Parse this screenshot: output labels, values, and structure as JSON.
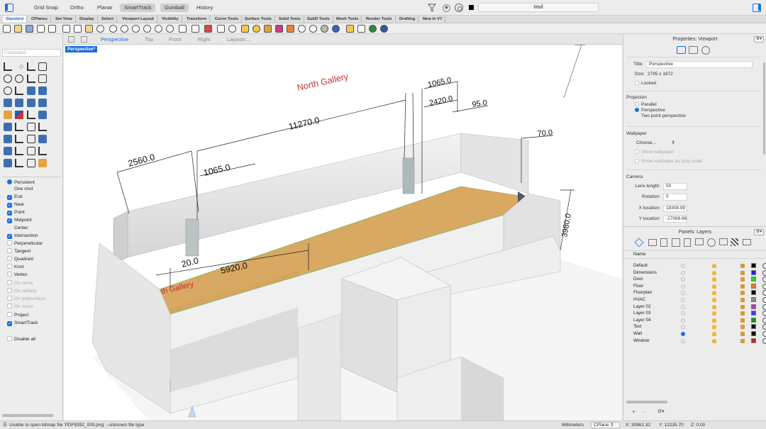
{
  "topbar": {
    "modes": [
      {
        "label": "Grid Snap",
        "on": false
      },
      {
        "label": "Ortho",
        "on": false
      },
      {
        "label": "Planar",
        "on": false
      },
      {
        "label": "SmartTrack",
        "on": true
      },
      {
        "label": "Gumball",
        "on": true
      },
      {
        "label": "History",
        "on": false
      }
    ],
    "current_layer": "Wall"
  },
  "tabs": [
    "Standard",
    "CPlanes",
    "Set View",
    "Display",
    "Select",
    "Viewport Layout",
    "Visibility",
    "Transform",
    "Curve Tools",
    "Surface Tools",
    "Solid Tools",
    "SubD Tools",
    "Mesh Tools",
    "Render Tools",
    "Drafting",
    "New in V7"
  ],
  "command": {
    "placeholder": "Command"
  },
  "osnaps": [
    {
      "label": "Persistent",
      "state": "radio-on"
    },
    {
      "label": "One shot",
      "state": "nobox"
    },
    {
      "label": "End",
      "state": "checked"
    },
    {
      "label": "Near",
      "state": "checked"
    },
    {
      "label": "Point",
      "state": "checked"
    },
    {
      "label": "Midpoint",
      "state": "checked"
    },
    {
      "label": "Center",
      "state": "nobox"
    },
    {
      "label": "Intersection",
      "state": "checked"
    },
    {
      "label": "Perpendicular",
      "state": "unchecked"
    },
    {
      "label": "Tangent",
      "state": "unchecked"
    },
    {
      "label": "Quadrant",
      "state": "unchecked"
    },
    {
      "label": "Knot",
      "state": "unchecked"
    },
    {
      "label": "Vertex",
      "state": "unchecked"
    },
    {
      "label": "On curve",
      "state": "dim"
    },
    {
      "label": "On surface",
      "state": "dim"
    },
    {
      "label": "On polysurface",
      "state": "dim"
    },
    {
      "label": "On mesh",
      "state": "dim"
    },
    {
      "label": "Project",
      "state": "unchecked"
    },
    {
      "label": "SmartTrack",
      "state": "checked"
    },
    {
      "label": "Disable all",
      "state": "unchecked"
    }
  ],
  "viewport_tabs": [
    "Perspective",
    "Top",
    "Front",
    "Right",
    "Layouts..."
  ],
  "viewport": {
    "label": "Perspective*",
    "annotations": {
      "gallery_top": "North Gallery",
      "gallery_bottom": "th Gallery",
      "dim_2560": "2560.0",
      "dim_1065_a": "1065.0",
      "dim_11270": "11270.0",
      "dim_1065_b": "1065.0",
      "dim_2420": "2420.0",
      "dim_95": "95.0",
      "dim_70": "70.0",
      "dim_3980": "3980.0",
      "dim_20": "20.0",
      "dim_5920": "5920.0"
    }
  },
  "properties": {
    "header": "Properties: Viewport",
    "title_label": "Title:",
    "title_value": "Perspective",
    "size_label": "Size:",
    "size_value": "2795 x 1872",
    "locked_label": "Locked",
    "projection_title": "Projection",
    "projection_options": [
      "Parallel",
      "Perspective",
      "Two point perspective"
    ],
    "wallpaper_title": "Wallpaper",
    "wallpaper_choose": "Choose...",
    "wallpaper_options": [
      "Show wallpaper",
      "Show wallpaper as gray scale"
    ],
    "camera_title": "Camera",
    "camera_fields": [
      {
        "label": "Lens length:",
        "value": "50"
      },
      {
        "label": "Rotation:",
        "value": "0"
      },
      {
        "label": "X location:",
        "value": "18308.99"
      },
      {
        "label": "Y location:",
        "value": "-17068.66"
      }
    ]
  },
  "layers_panel": {
    "header": "Panels: Layers",
    "name_col": "Name",
    "rows": [
      {
        "name": "Default",
        "current": false,
        "color": "#000000"
      },
      {
        "name": "Dimensions",
        "current": false,
        "color": "#1e1ef0"
      },
      {
        "name": "Door",
        "current": false,
        "color": "#2ad62a"
      },
      {
        "name": "Floor",
        "current": false,
        "color": "#e07b22"
      },
      {
        "name": "Floorplan",
        "current": false,
        "color": "#000000"
      },
      {
        "name": "HVAC",
        "current": false,
        "color": "#9a8a7a"
      },
      {
        "name": "Layer 02",
        "current": false,
        "color": "#c233c2"
      },
      {
        "name": "Layer 03",
        "current": false,
        "color": "#3344dd"
      },
      {
        "name": "Layer 04",
        "current": false,
        "color": "#1f8a1f"
      },
      {
        "name": "Text",
        "current": false,
        "color": "#111111"
      },
      {
        "name": "Wall",
        "current": true,
        "color": "#000000"
      },
      {
        "name": "Window",
        "current": false,
        "color": "#d42020"
      }
    ]
  },
  "status": {
    "message": "Unable to open bitmap file 'PDF8392_000.png' - unknown file type",
    "units": "Millimeters",
    "cplane": "CPlane",
    "x": "X: 30861.32",
    "y": "Y: 12235.70",
    "z": "Z: 0.00"
  }
}
